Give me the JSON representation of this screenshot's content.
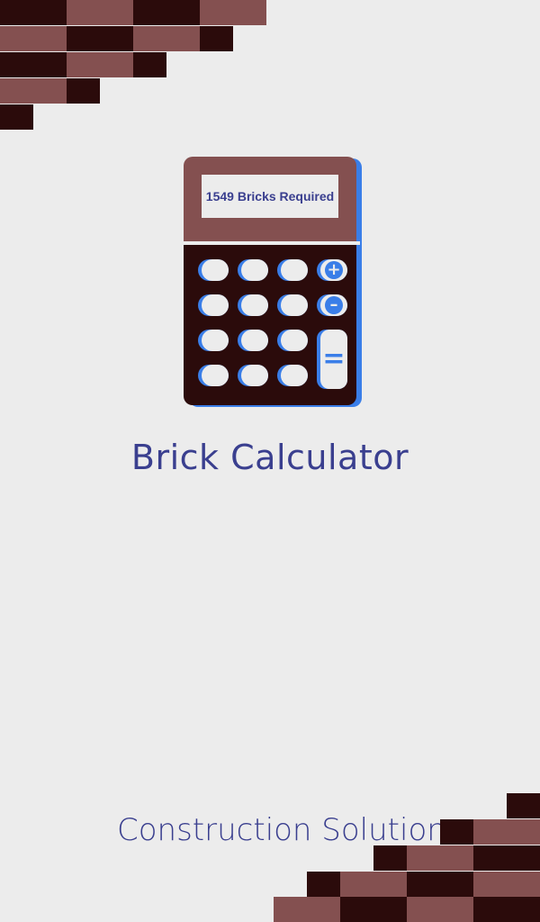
{
  "colors": {
    "background": "#ececec",
    "brick_light": "#845050",
    "brick_dark": "#2b0b0b",
    "accent_blue": "#3a7ee8",
    "text_navy": "#3a3f8f"
  },
  "calculator": {
    "display_text": "1549 Bricks Required",
    "plus_symbol": "+",
    "minus_symbol": "–",
    "equals_symbol": "="
  },
  "app": {
    "title": "Brick Calculator",
    "tagline": "Construction Solution"
  }
}
